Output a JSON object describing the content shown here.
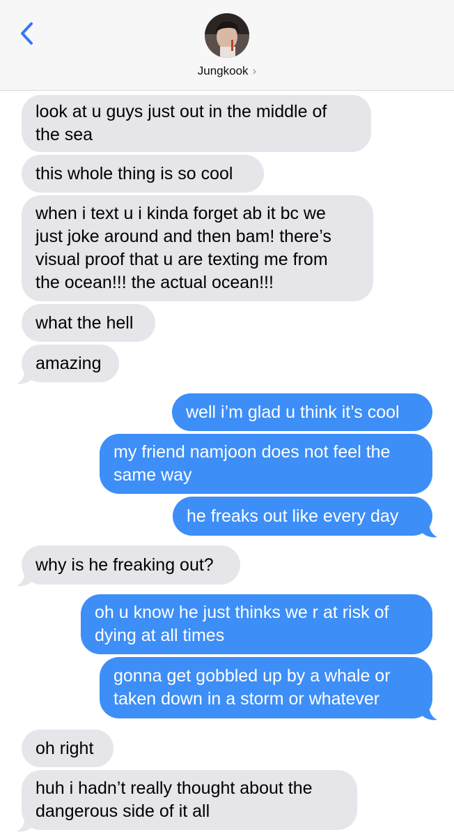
{
  "header": {
    "contact_name": "Jungkook",
    "chevron": "›",
    "back_icon": "chevron-left-icon",
    "accent_color": "#3478f6"
  },
  "colors": {
    "incoming_bubble": "#e5e5ea",
    "outgoing_bubble": "#3d8ef7"
  },
  "messages": [
    {
      "from": "them",
      "lines": [
        "look at u guys just out in the middle of",
        "the sea"
      ]
    },
    {
      "from": "them",
      "lines": [
        "this whole thing is so cool"
      ]
    },
    {
      "from": "them",
      "lines": [
        "when i text u i kinda forget ab it bc we",
        "just joke around and then bam! there’s",
        "visual proof that u are texting me from",
        "the ocean!!! the actual ocean!!!"
      ]
    },
    {
      "from": "them",
      "lines": [
        "what the hell"
      ]
    },
    {
      "from": "them",
      "lines": [
        "amazing"
      ]
    },
    {
      "from": "me",
      "lines": [
        "well i’m glad u think it’s cool"
      ]
    },
    {
      "from": "me",
      "lines": [
        "my friend namjoon does not feel the",
        "same way"
      ]
    },
    {
      "from": "me",
      "lines": [
        "he freaks out like every day"
      ]
    },
    {
      "from": "them",
      "lines": [
        "why is he freaking out?"
      ]
    },
    {
      "from": "me",
      "lines": [
        "oh u know he just thinks we r at risk of",
        "dying at all times"
      ]
    },
    {
      "from": "me",
      "lines": [
        "gonna get gobbled up by a whale or",
        "taken down in a storm or whatever"
      ]
    },
    {
      "from": "them",
      "lines": [
        "oh right"
      ]
    },
    {
      "from": "them",
      "lines": [
        "huh i hadn’t really thought about the",
        "dangerous side of it all"
      ]
    }
  ]
}
